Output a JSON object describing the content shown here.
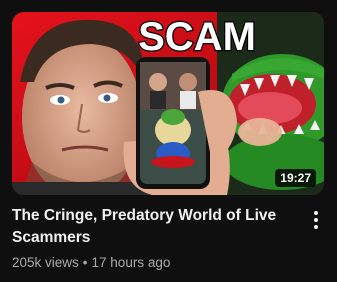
{
  "video": {
    "thumbnail": {
      "overlay_text": "SCAM",
      "duration": "19:27"
    },
    "title": "The Cringe, Predatory World of Live Scammers",
    "views": "205k views",
    "separator": "•",
    "age": "17 hours ago",
    "menu_icon": "more-vert-icon"
  },
  "colors": {
    "background": "#0f0f0f",
    "title": "#f1f1f1",
    "meta": "#aaaaaa",
    "thumb_red": "#c8101a",
    "crocodile_green": "#2f9a2a"
  }
}
